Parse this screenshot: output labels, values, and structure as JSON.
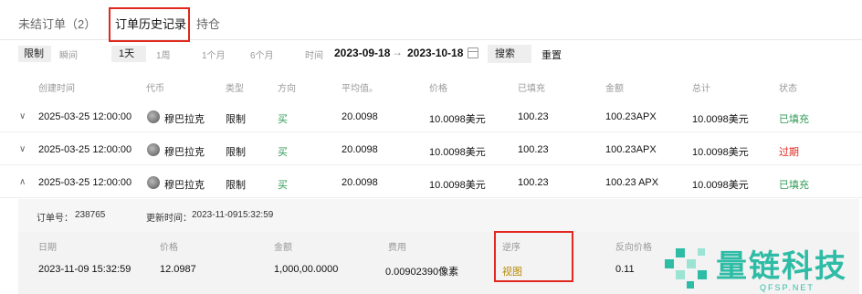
{
  "tabs": [
    {
      "label": "未结订单（2）"
    },
    {
      "label": "订单历史记录"
    },
    {
      "label": "持仓"
    }
  ],
  "filters": {
    "order_type": "限制",
    "range_label": "瞬间",
    "ranges": [
      "1天",
      "1周",
      "1个月",
      "6个月"
    ],
    "time_label": "时间",
    "start_date": "2023-09-18",
    "arrow": "→",
    "end_date": "2023-10-18",
    "search": "搜索",
    "reset": "重置"
  },
  "table": {
    "headers": [
      "创建时间",
      "代币",
      "类型",
      "方向",
      "平均值。",
      "价格",
      "已填充",
      "金额",
      "总计",
      "状态"
    ],
    "rows": [
      {
        "chevron": "∨",
        "time": "2025-03-25 12:00:00",
        "token": "穆巴拉克",
        "type": "限制",
        "side": "买",
        "avg": "20.0098",
        "price": "10.0098美元",
        "filled": "100.23",
        "amount": "100.23APX",
        "total": "10.0098美元",
        "status": "已填充"
      },
      {
        "chevron": "∨",
        "time": "2025-03-25 12:00:00",
        "token": "穆巴拉克",
        "type": "限制",
        "side": "买",
        "avg": "20.0098",
        "price": "10.0098美元",
        "filled": "100.23",
        "amount": "100.23APX",
        "total": "10.0098美元",
        "status": "过期"
      },
      {
        "chevron": "∧",
        "time": "2025-03-25 12:00:00",
        "token": "穆巴拉克",
        "type": "限制",
        "side": "买",
        "avg": "20.0098",
        "price": "10.0098美元",
        "filled": "100.23",
        "amount": "100.23 APX",
        "total": "10.0098美元",
        "status": "已填充"
      }
    ]
  },
  "detail": {
    "order_no_label": "订单号：",
    "order_no": "238765",
    "updated_label": "更新时间：",
    "updated": "2023-11-0915:32:59",
    "headers": [
      "日期",
      "价格",
      "金额",
      "费用",
      "逆序",
      "反向价格"
    ],
    "row": {
      "date": "2023-11-09 15:32:59",
      "price": "12.0987",
      "amount": "1,000,00.0000",
      "fee": "0.00902390像素",
      "reverse": "视图",
      "reverse_price": "0.11"
    }
  },
  "watermark": {
    "text": "量链科技",
    "url": "QFSP.NET"
  },
  "colors": {
    "accent_red": "#e0281e",
    "buy_green": "#2e9a55",
    "link_gold": "#b88a00",
    "brand_teal": "#2fbca6"
  }
}
